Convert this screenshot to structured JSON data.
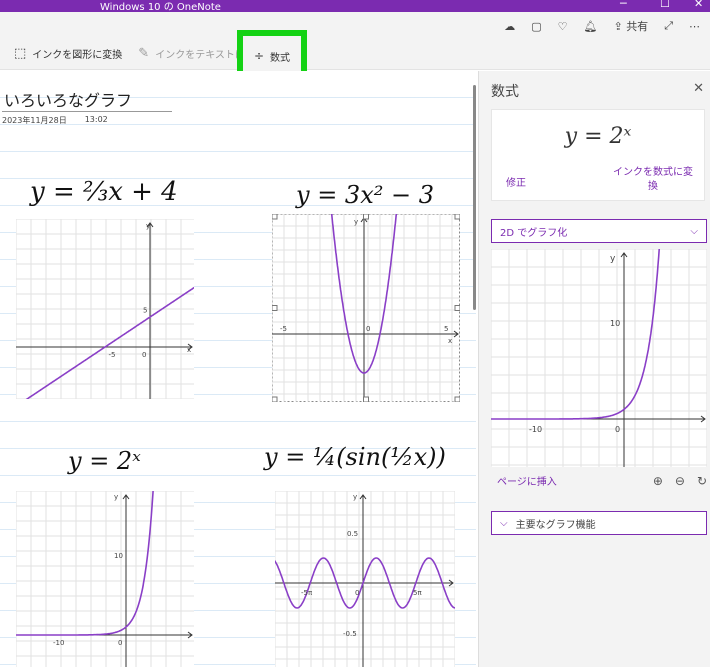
{
  "window": {
    "title": "Windows 10 の OneNote"
  },
  "topbar": {
    "share_label": "共有",
    "icons": [
      "feed-icon",
      "notebook-icon",
      "lightbulb-icon",
      "bell-icon",
      "share-icon",
      "expand-icon",
      "more-icon"
    ]
  },
  "ribbon": {
    "ink_to_shape": "インクを図形に変換",
    "ink_to_text": "インクをテキストに変換",
    "math": "数式"
  },
  "page": {
    "title": "いろいろなグラフ",
    "date": "2023年11月28日",
    "time": "13:02"
  },
  "notes": [
    {
      "equation": "y = ⅔x + 4",
      "chart_data": {
        "type": "line",
        "xlabel": "x",
        "ylabel": "y",
        "ticks_x": [
          "-5",
          "0"
        ],
        "ticks_y": [
          "5"
        ],
        "x": [
          -10,
          5
        ],
        "y": [
          -2.67,
          7.33
        ]
      }
    },
    {
      "equation": "y = 3x² − 3",
      "chart_data": {
        "type": "line",
        "xlabel": "x",
        "ylabel": "y",
        "ticks_x": [
          "-5",
          "0",
          "5"
        ],
        "ticks_y": [],
        "x": [
          -1.6,
          -1.2,
          -0.8,
          -0.4,
          0,
          0.4,
          0.8,
          1.2,
          1.6
        ],
        "y": [
          4.68,
          1.32,
          -1.08,
          -2.52,
          -3,
          -2.52,
          -1.08,
          1.32,
          4.68
        ]
      }
    },
    {
      "equation": "y = 2ˣ",
      "chart_data": {
        "type": "line",
        "xlabel": "",
        "ylabel": "y",
        "ticks_x": [
          "-10",
          "0"
        ],
        "ticks_y": [
          "10"
        ],
        "x": [
          -14,
          -8,
          -4,
          -2,
          0,
          1,
          2,
          3,
          4
        ],
        "y": [
          0,
          0,
          0.06,
          0.25,
          1,
          2,
          4,
          8,
          16
        ]
      }
    },
    {
      "equation": "y = ¼(sin(½x))",
      "chart_data": {
        "type": "line",
        "xlabel": "",
        "ylabel": "y",
        "ticks_x": [
          "-5π",
          "0",
          "5π"
        ],
        "ticks_y": [
          "0.5",
          "-0.5"
        ],
        "x": [
          -25,
          25
        ],
        "y": [
          -0.25,
          0.25
        ]
      }
    }
  ],
  "pane": {
    "title": "数式",
    "formula": "y = 2ˣ",
    "edit_label": "修正",
    "convert_label": "インクを数式に変換",
    "graph_mode": "2D でグラフ化",
    "insert_label": "ページに挿入",
    "features_label": "主要なグラフ機能",
    "chart_data": {
      "type": "line",
      "xlabel": "",
      "ylabel": "y",
      "ticks_x": [
        "-10",
        "0"
      ],
      "ticks_y": [
        "10"
      ],
      "x": [
        -14,
        -8,
        -4,
        -2,
        0,
        1,
        2,
        3,
        4
      ],
      "y": [
        0,
        0,
        0.06,
        0.25,
        1,
        2,
        4,
        8,
        16
      ]
    }
  },
  "colors": {
    "accent": "#7b2bb0",
    "highlight": "#14d214",
    "curve": "#8a3fc7"
  }
}
